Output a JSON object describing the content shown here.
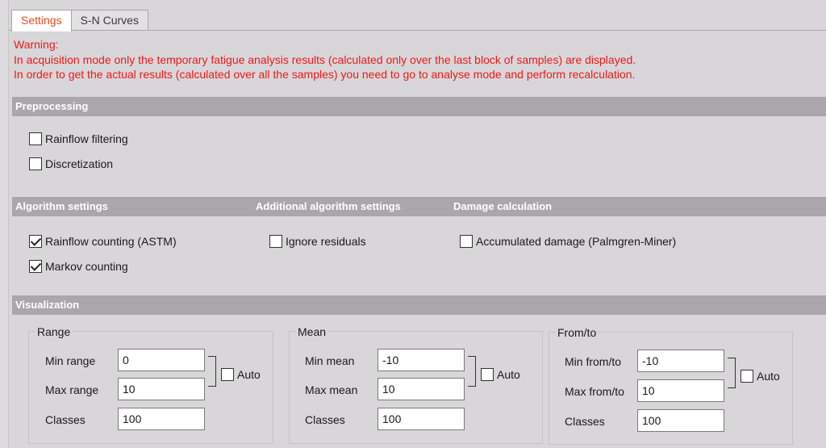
{
  "tabs": [
    {
      "label": "Settings",
      "active": true
    },
    {
      "label": "S-N Curves",
      "active": false
    }
  ],
  "warning": {
    "title": "Warning:",
    "line1": "In acquisition mode only the temporary fatigue analysis results (calculated only over the last block of samples) are displayed.",
    "line2": "In order to get the actual results (calculated over all the samples) you need to go to analyse mode and perform recalculation."
  },
  "preprocessing": {
    "header": "Preprocessing",
    "rainflow_filtering": {
      "label": "Rainflow filtering",
      "checked": false
    },
    "discretization": {
      "label": "Discretization",
      "checked": false
    }
  },
  "algorithm": {
    "header": "Algorithm settings",
    "additional_header": "Additional algorithm settings",
    "damage_header": "Damage calculation",
    "rainflow_astm": {
      "label": "Rainflow counting (ASTM)",
      "checked": true
    },
    "markov": {
      "label": "Markov counting",
      "checked": true
    },
    "ignore_residuals": {
      "label": "Ignore residuals",
      "checked": false
    },
    "accumulated_damage": {
      "label": "Accumulated damage (Palmgren-Miner)",
      "checked": false
    }
  },
  "visualization": {
    "header": "Visualization",
    "range": {
      "title": "Range",
      "min_label": "Min range",
      "min_value": "0",
      "max_label": "Max range",
      "max_value": "10",
      "classes_label": "Classes",
      "classes_value": "100",
      "auto_label": "Auto",
      "auto_checked": false
    },
    "mean": {
      "title": "Mean",
      "min_label": "Min mean",
      "min_value": "-10",
      "max_label": "Max mean",
      "max_value": "10",
      "classes_label": "Classes",
      "classes_value": "100",
      "auto_label": "Auto",
      "auto_checked": false
    },
    "fromto": {
      "title": "From/to",
      "min_label": "Min from/to",
      "min_value": "-10",
      "max_label": "Max from/to",
      "max_value": "10",
      "classes_label": "Classes",
      "classes_value": "100",
      "auto_label": "Auto",
      "auto_checked": false
    }
  },
  "colors": {
    "active_tab": "#f04a24",
    "warning": "#f01818",
    "section_header": "#a9a7a9"
  }
}
